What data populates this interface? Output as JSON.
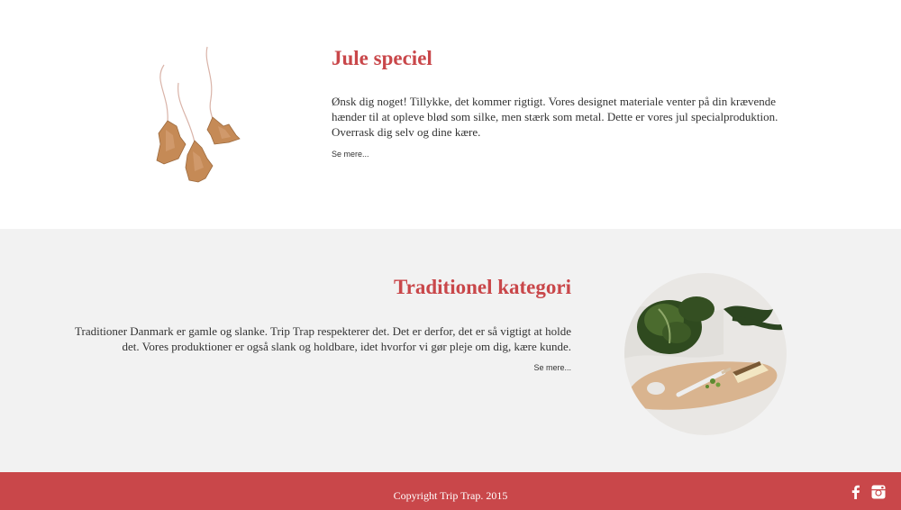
{
  "jule": {
    "title": "Jule speciel",
    "text": "Ønsk dig noget! Tillykke, det kommer rigtigt. Vores designet materiale venter på din krævende hænder til at opleve blød som silke, men stærk som metal. Dette er vores jul specialproduktion. Overrask dig selv og dine kære.",
    "more": "Se mere..."
  },
  "traditionel": {
    "title": "Traditionel kategori",
    "text": "Traditioner Danmark er gamle og slanke. Trip Trap respekterer det. Det er derfor, det er så vigtigt at holde det. Vores produktioner er også slank og holdbare, idet hvorfor vi gør pleje om dig, kære kunde.",
    "more": "Se mere..."
  },
  "footer": {
    "copyright": "Copyright Trip Trap. 2015",
    "social": [
      "facebook-icon",
      "instagram-icon"
    ]
  },
  "colors": {
    "accent": "#c9474a",
    "band": "#f2f2f2"
  }
}
